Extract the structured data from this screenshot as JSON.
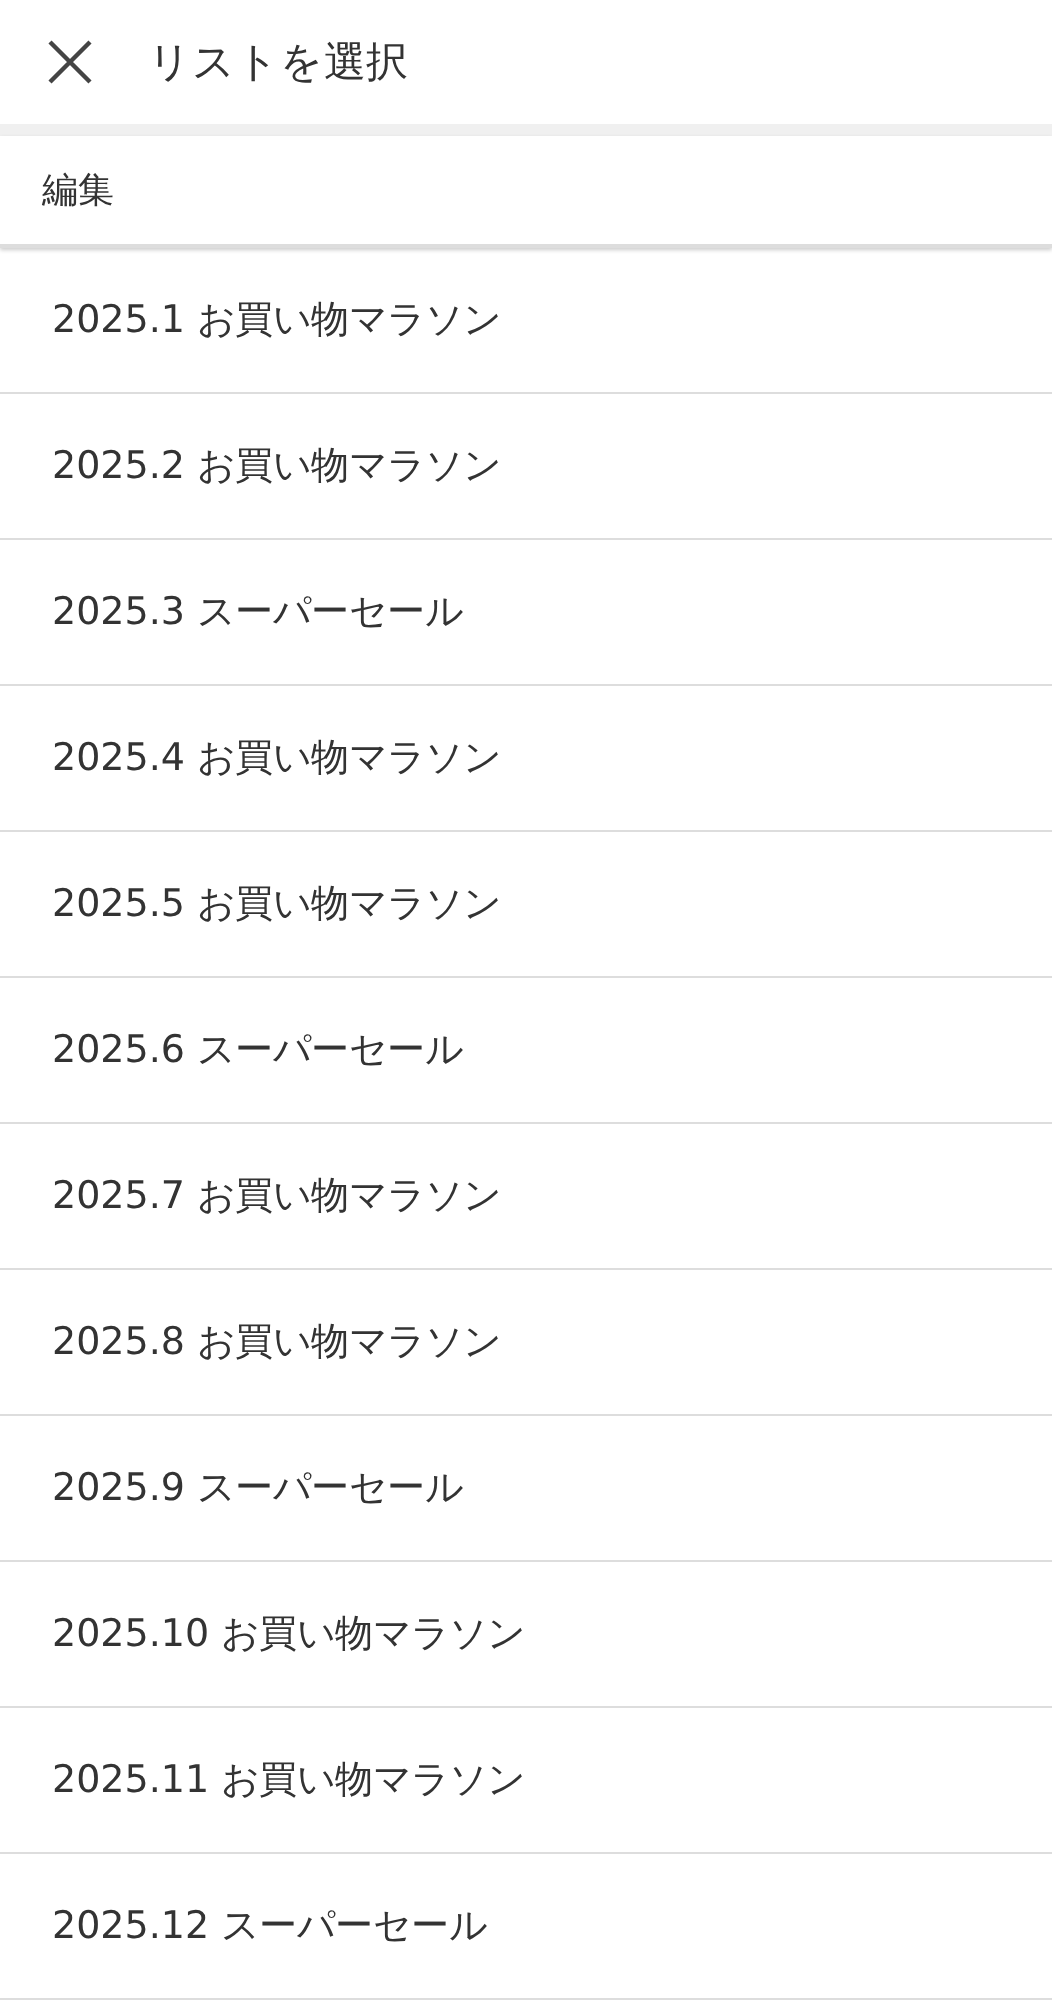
{
  "header": {
    "title": "リストを選択"
  },
  "edit": {
    "label": "編集"
  },
  "lists": [
    {
      "label": "2025.1 お買い物マラソン"
    },
    {
      "label": "2025.2 お買い物マラソン"
    },
    {
      "label": "2025.3 スーパーセール"
    },
    {
      "label": "2025.4 お買い物マラソン"
    },
    {
      "label": "2025.5 お買い物マラソン"
    },
    {
      "label": "2025.6 スーパーセール"
    },
    {
      "label": "2025.7 お買い物マラソン"
    },
    {
      "label": "2025.8 お買い物マラソン"
    },
    {
      "label": "2025.9 スーパーセール"
    },
    {
      "label": "2025.10 お買い物マラソン"
    },
    {
      "label": "2025.11 お買い物マラソン"
    },
    {
      "label": "2025.12 スーパーセール"
    }
  ]
}
